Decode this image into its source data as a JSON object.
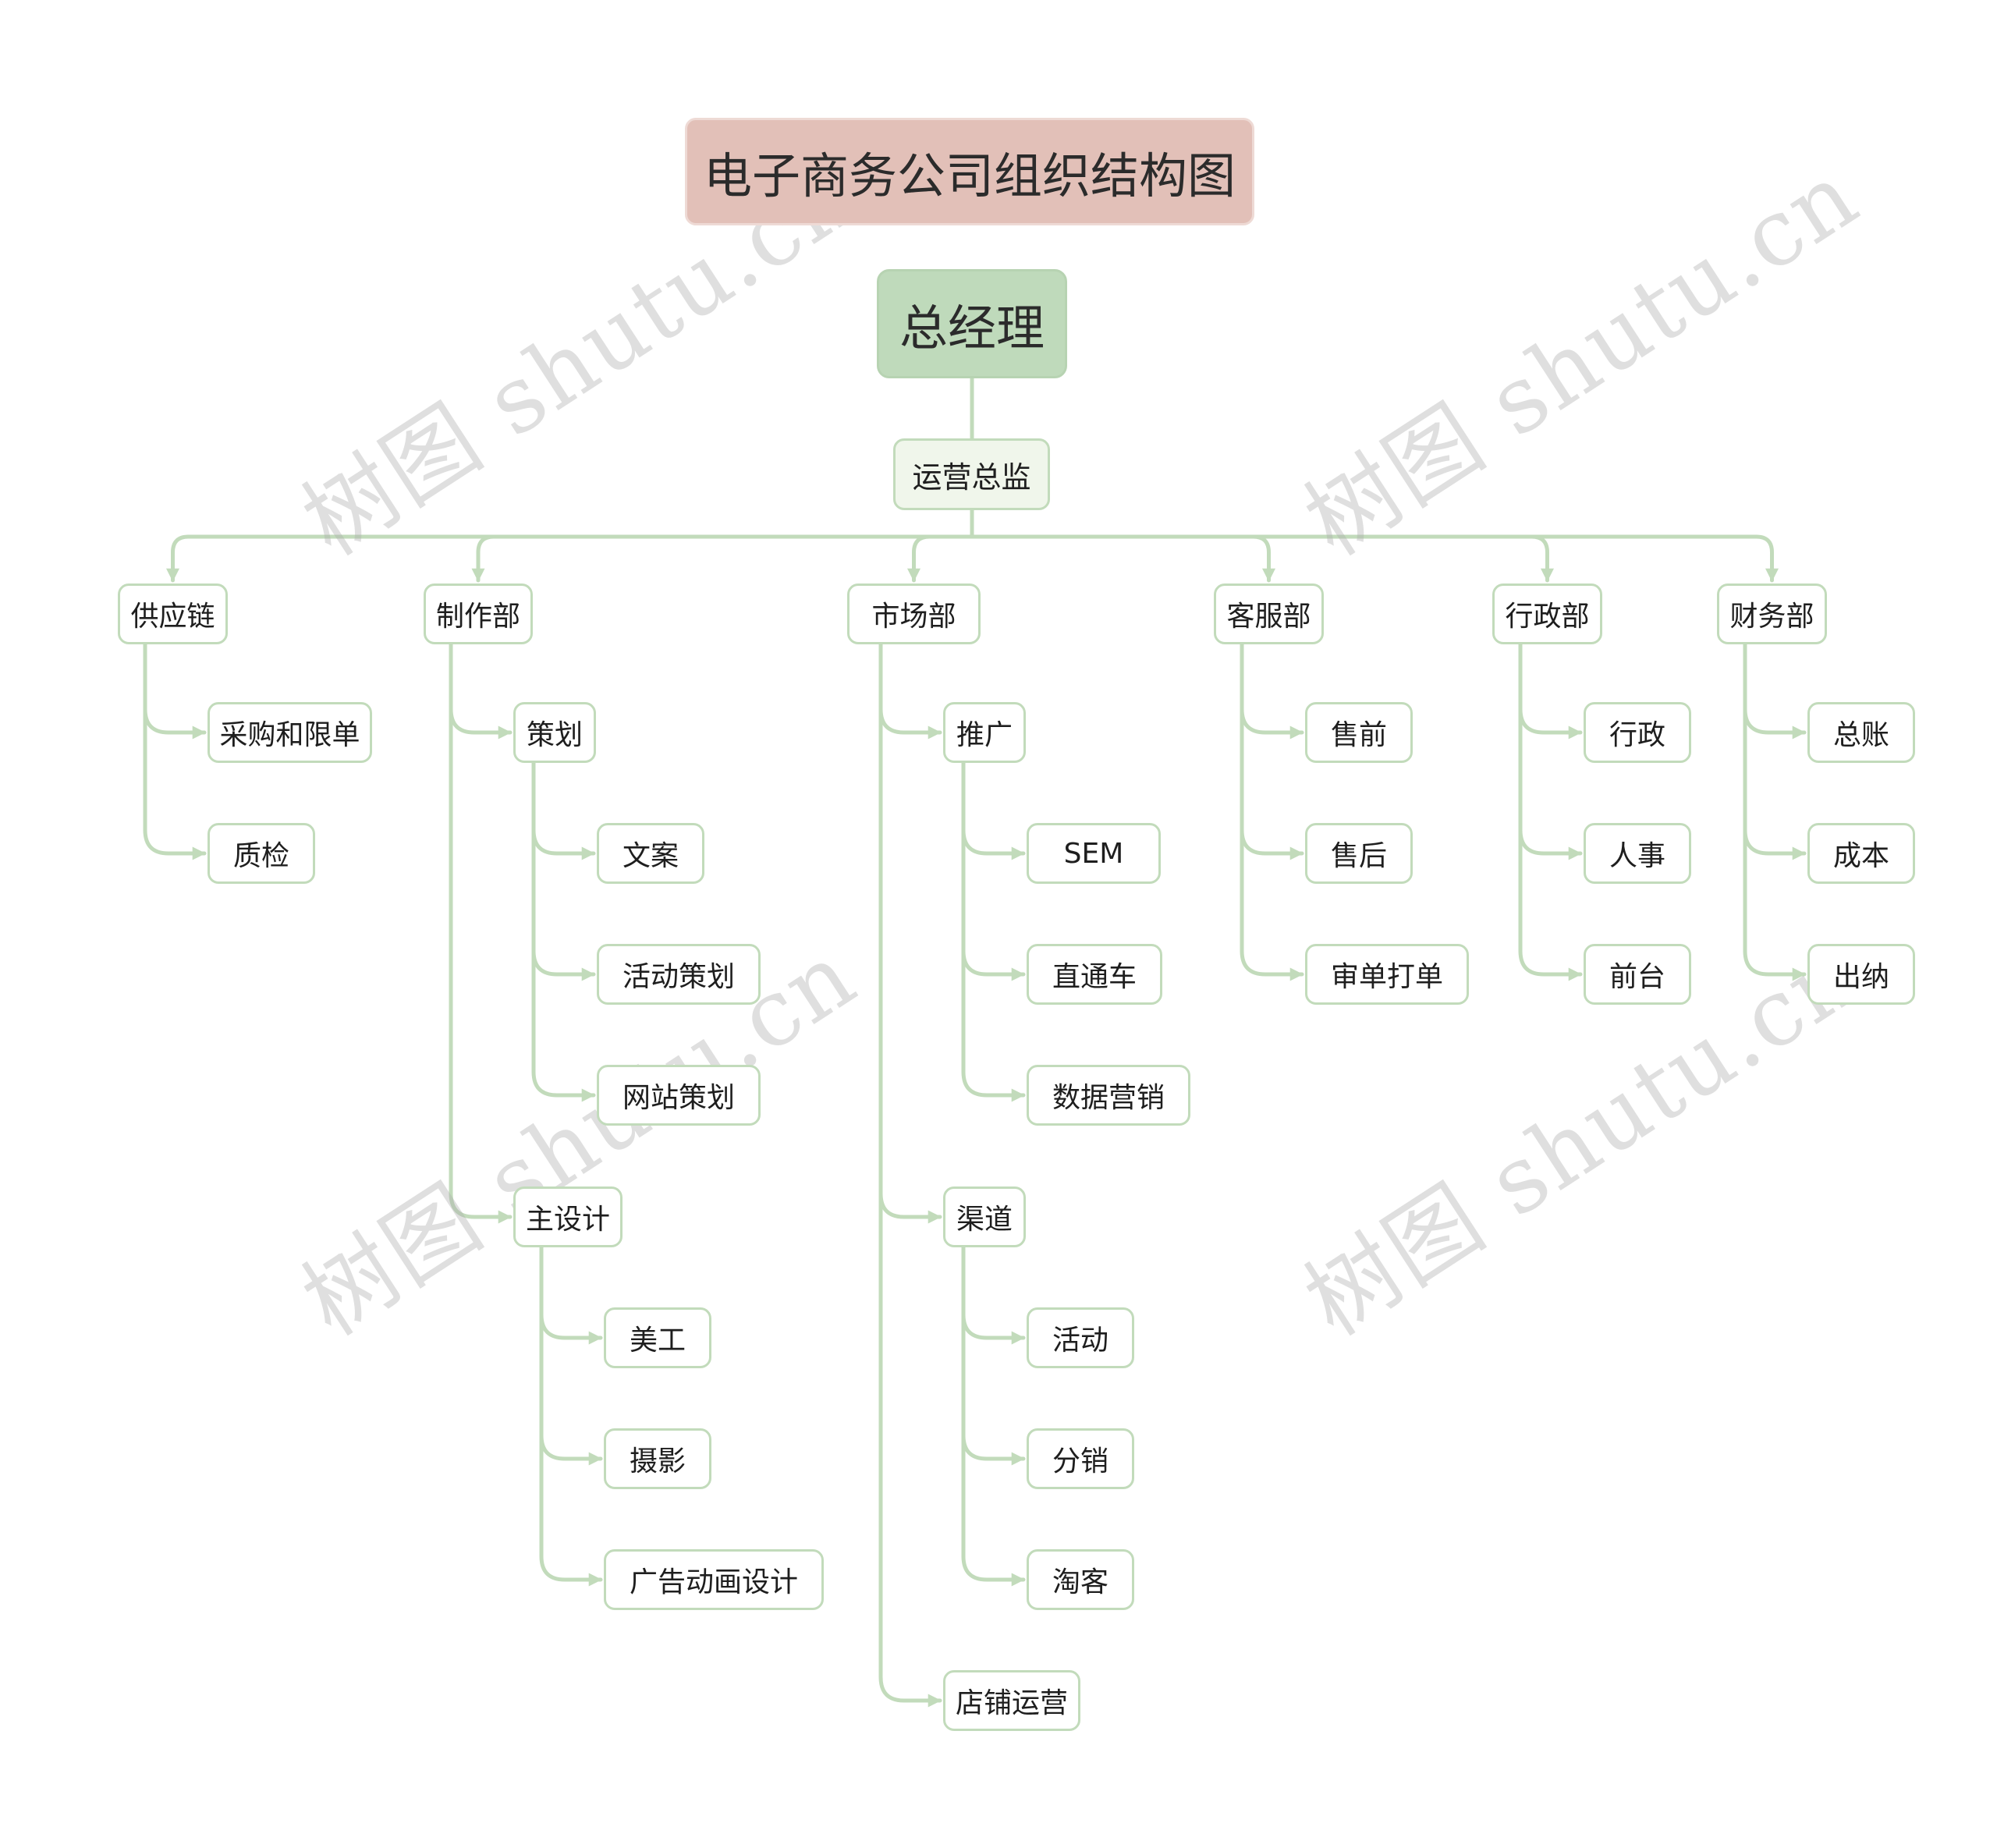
{
  "title": "电子商务公司组织结构图",
  "root": "总经理",
  "director": "运营总监",
  "colors": {
    "title_bg": "#e2c0b8",
    "root_bg": "#bfdabb",
    "director_bg": "#f0f6eb",
    "connector": "#c2dbbb",
    "node_border": "#c2dbbb"
  },
  "watermark": "树图 shutu.cn",
  "departments": [
    {
      "name": "供应链",
      "children": [
        {
          "name": "采购和限单"
        },
        {
          "name": "质检"
        }
      ]
    },
    {
      "name": "制作部",
      "children": [
        {
          "name": "策划",
          "children": [
            {
              "name": "文案"
            },
            {
              "name": "活动策划"
            },
            {
              "name": "网站策划"
            }
          ]
        },
        {
          "name": "主设计",
          "children": [
            {
              "name": "美工"
            },
            {
              "name": "摄影"
            },
            {
              "name": "广告动画设计"
            }
          ]
        }
      ]
    },
    {
      "name": "市场部",
      "children": [
        {
          "name": "推广",
          "children": [
            {
              "name": "SEM"
            },
            {
              "name": "直通车"
            },
            {
              "name": "数据营销"
            }
          ]
        },
        {
          "name": "渠道",
          "children": [
            {
              "name": "活动"
            },
            {
              "name": "分销"
            },
            {
              "name": "淘客"
            }
          ]
        },
        {
          "name": "店铺运营"
        }
      ]
    },
    {
      "name": "客服部",
      "children": [
        {
          "name": "售前"
        },
        {
          "name": "售后"
        },
        {
          "name": "审单打单"
        }
      ]
    },
    {
      "name": "行政部",
      "children": [
        {
          "name": "行政"
        },
        {
          "name": "人事"
        },
        {
          "name": "前台"
        }
      ]
    },
    {
      "name": "财务部",
      "children": [
        {
          "name": "总账"
        },
        {
          "name": "成本"
        },
        {
          "name": "出纳"
        }
      ]
    }
  ]
}
